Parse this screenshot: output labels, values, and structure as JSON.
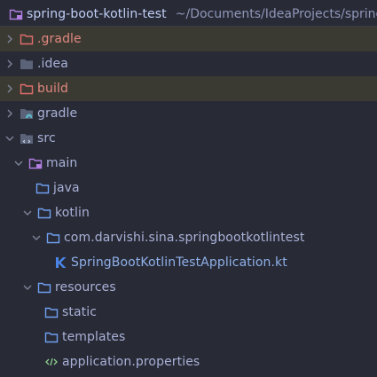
{
  "project": {
    "name": "spring-boot-kotlin-test",
    "path": "~/Documents/IdeaProjects/spring"
  },
  "tree": [
    {
      "label": ".gradle",
      "icon": "folder-excluded-icon",
      "expanded": false
    },
    {
      "label": ".idea",
      "icon": "folder-icon",
      "expanded": false
    },
    {
      "label": "build",
      "icon": "folder-excluded-icon",
      "expanded": false
    },
    {
      "label": "gradle",
      "icon": "folder-gradle-icon",
      "expanded": false
    },
    {
      "label": "src",
      "icon": "folder-src-icon",
      "expanded": true
    },
    {
      "label": "main",
      "icon": "folder-module-icon",
      "expanded": true
    },
    {
      "label": "java",
      "icon": "folder-source-icon",
      "expanded": null
    },
    {
      "label": "kotlin",
      "icon": "folder-source-icon",
      "expanded": true
    },
    {
      "label": "com.darvishi.sina.springbootkotlintest",
      "icon": "package-icon",
      "expanded": true
    },
    {
      "label": "SpringBootKotlinTestApplication.kt",
      "icon": "kotlin-file-icon",
      "expanded": null
    },
    {
      "label": "resources",
      "icon": "folder-resources-icon",
      "expanded": true
    },
    {
      "label": "static",
      "icon": "folder-source-icon",
      "expanded": null
    },
    {
      "label": "templates",
      "icon": "folder-source-icon",
      "expanded": null
    },
    {
      "label": "application.properties",
      "icon": "properties-file-icon",
      "expanded": null
    }
  ],
  "colors": {
    "background": "#282a36",
    "excluded_row": "#3b3a32",
    "folder_blue": "#6f9ff0",
    "folder_excluded": "#e06c6c",
    "kotlin_blue": "#4a86e8"
  }
}
